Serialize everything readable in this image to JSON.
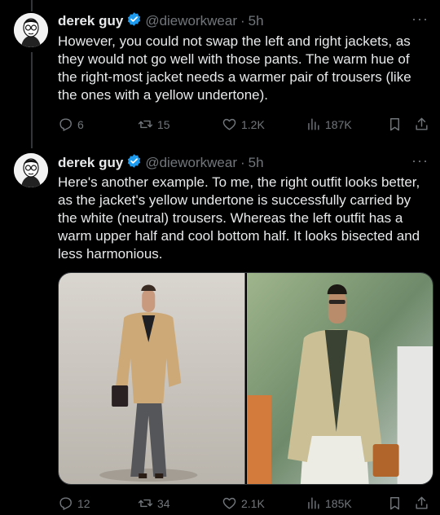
{
  "tweets": [
    {
      "name": "derek guy",
      "handle": "@dieworkwear",
      "dot": "·",
      "time": "5h",
      "text": "However, you could not swap the left and right jackets, as they would not go well with those pants. The warm hue of the right-most jacket needs a warmer pair of trousers (like the ones with a yellow undertone).",
      "replies": "6",
      "retweets": "15",
      "likes": "1.2K",
      "views": "187K"
    },
    {
      "name": "derek guy",
      "handle": "@dieworkwear",
      "dot": "·",
      "time": "5h",
      "text": "Here's another example. To me, the right outfit looks better, as the jacket's yellow undertone is successfully carried by the white (neutral) trousers. Whereas the left outfit has a warm upper half and cool bottom half. It looks bisected and less harmonious.",
      "replies": "12",
      "retweets": "34",
      "likes": "2.1K",
      "views": "185K"
    }
  ],
  "more_label": "···",
  "colors": {
    "background": "#000000",
    "text": "#e7e9ea",
    "muted": "#71767b",
    "verified": "#1d9bf0"
  },
  "icons": [
    "reply-icon",
    "retweet-icon",
    "like-icon",
    "views-icon",
    "bookmark-icon",
    "share-icon",
    "verified-badge-icon",
    "more-icon"
  ]
}
